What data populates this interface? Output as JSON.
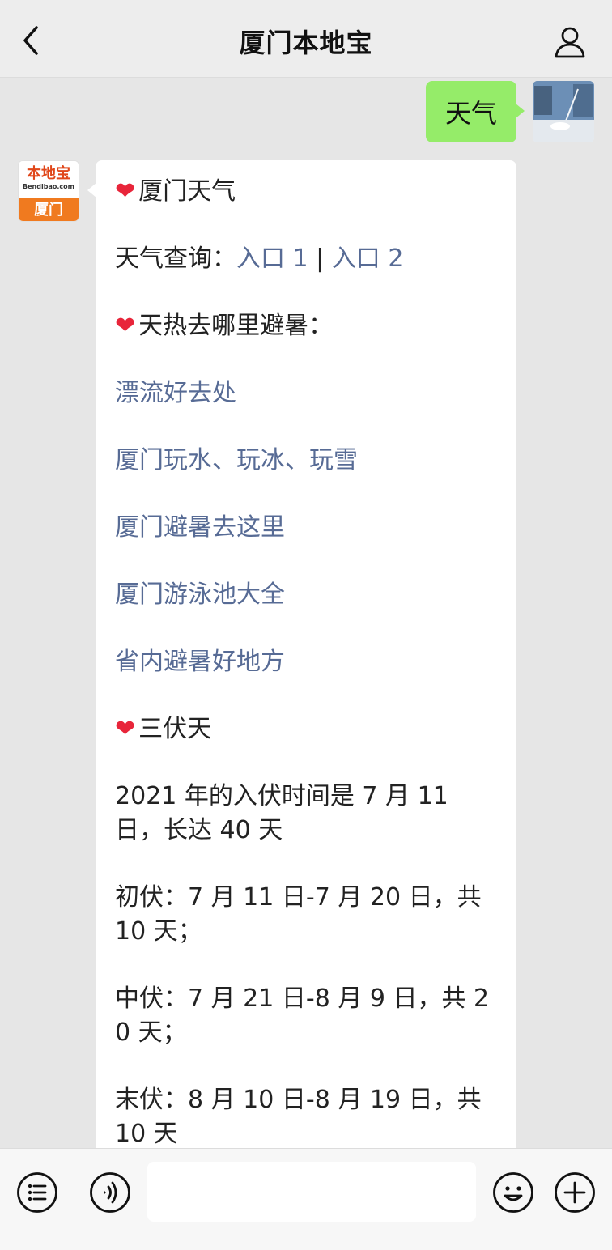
{
  "header": {
    "title": "厦门本地宝"
  },
  "outgoing": {
    "text": "天气"
  },
  "bot": {
    "avatar_top": "本地宝",
    "avatar_domain": "Bendibao.com",
    "avatar_city": "厦门"
  },
  "message": {
    "weather_heading": "厦门天气",
    "query_label": "天气查询：",
    "link_entry1": "入口 1",
    "sep": " | ",
    "link_entry2": "入口 2",
    "summer_heading": "天热去哪里避暑：",
    "links": [
      "漂流好去处",
      "厦门玩水、玩冰、玩雪",
      "厦门避暑去这里",
      "厦门游泳池大全",
      "省内避暑好地方"
    ],
    "sanfu_heading": "三伏天",
    "sanfu_intro": "2021 年的入伏时间是 7 月 11 日，长达 40 天",
    "chufu": "初伏：7 月 11 日-7 月 20 日，共 10 天；",
    "zhongfu": "中伏：7 月 21 日-8 月 9 日，共 20 天；",
    "mofu": "末伏：8 月 10 日-8 月 19 日，共 10 天"
  },
  "icons": {
    "back": "chevron-left-icon",
    "profile": "person-icon",
    "menu": "list-icon",
    "voice": "voice-icon",
    "emoji": "emoji-icon",
    "plus": "plus-icon"
  }
}
